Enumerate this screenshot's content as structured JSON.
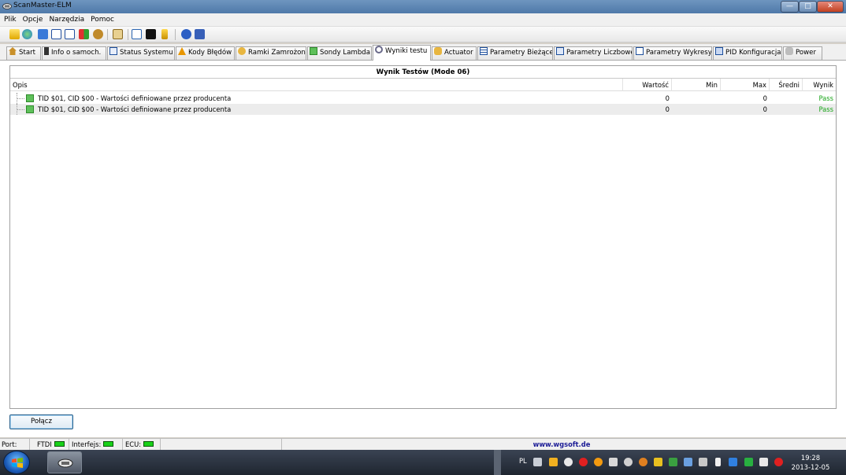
{
  "window": {
    "title": "ScanMaster-ELM",
    "min_glyph": "—",
    "max_glyph": "□",
    "close_glyph": "✕"
  },
  "menu": [
    "Plik",
    "Opcje",
    "Narzędzia",
    "Pomoc"
  ],
  "tabs": [
    {
      "label": "Start",
      "icon": "home-icon"
    },
    {
      "label": "Info o samoch.",
      "icon": "info-icon"
    },
    {
      "label": "Status Systemu",
      "icon": "status-icon"
    },
    {
      "label": "Kody Błędów",
      "icon": "warning-icon"
    },
    {
      "label": "Ramki Zamrożone",
      "icon": "freeze-frame-icon"
    },
    {
      "label": "Sondy Lambda",
      "icon": "lambda-sensor-icon"
    },
    {
      "label": "Wyniki testu",
      "icon": "gear-icon",
      "active": true
    },
    {
      "label": "Actuator",
      "icon": "actuator-icon"
    },
    {
      "label": "Parametry Bieżące",
      "icon": "list-icon"
    },
    {
      "label": "Parametry Liczbowe",
      "icon": "table-icon"
    },
    {
      "label": "Parametry Wykresy",
      "icon": "graph-icon"
    },
    {
      "label": "PID Konfiguracja",
      "icon": "config-icon"
    },
    {
      "label": "Power",
      "icon": "power-icon"
    }
  ],
  "grid": {
    "title": "Wynik Testów (Mode 06)",
    "columns": [
      "Opis",
      "Wartość",
      "Min",
      "Max",
      "Średni",
      "Wynik"
    ],
    "rows": [
      {
        "opis": "TID $01, CID $00 - Wartości definiowane przez producenta",
        "wartosc": "0",
        "min": "",
        "max": "0",
        "sredni": "",
        "wynik": "Pass"
      },
      {
        "opis": "TID $01, CID $00 - Wartości definiowane przez producenta",
        "wartosc": "0",
        "min": "",
        "max": "0",
        "sredni": "",
        "wynik": "Pass"
      }
    ]
  },
  "connect_button": "Połącz",
  "statusbar": {
    "port_label": "Port:",
    "port_value": "FTDI",
    "interface_label": "Interfejs:",
    "ecu_label": "ECU:",
    "website": "www.wgsoft.de"
  },
  "taskbar": {
    "language": "PL",
    "time": "19:28",
    "date": "2013-12-05"
  },
  "colors": {
    "pass": "#18a518",
    "led_on": "#19d119",
    "website": "#1c1c96"
  }
}
